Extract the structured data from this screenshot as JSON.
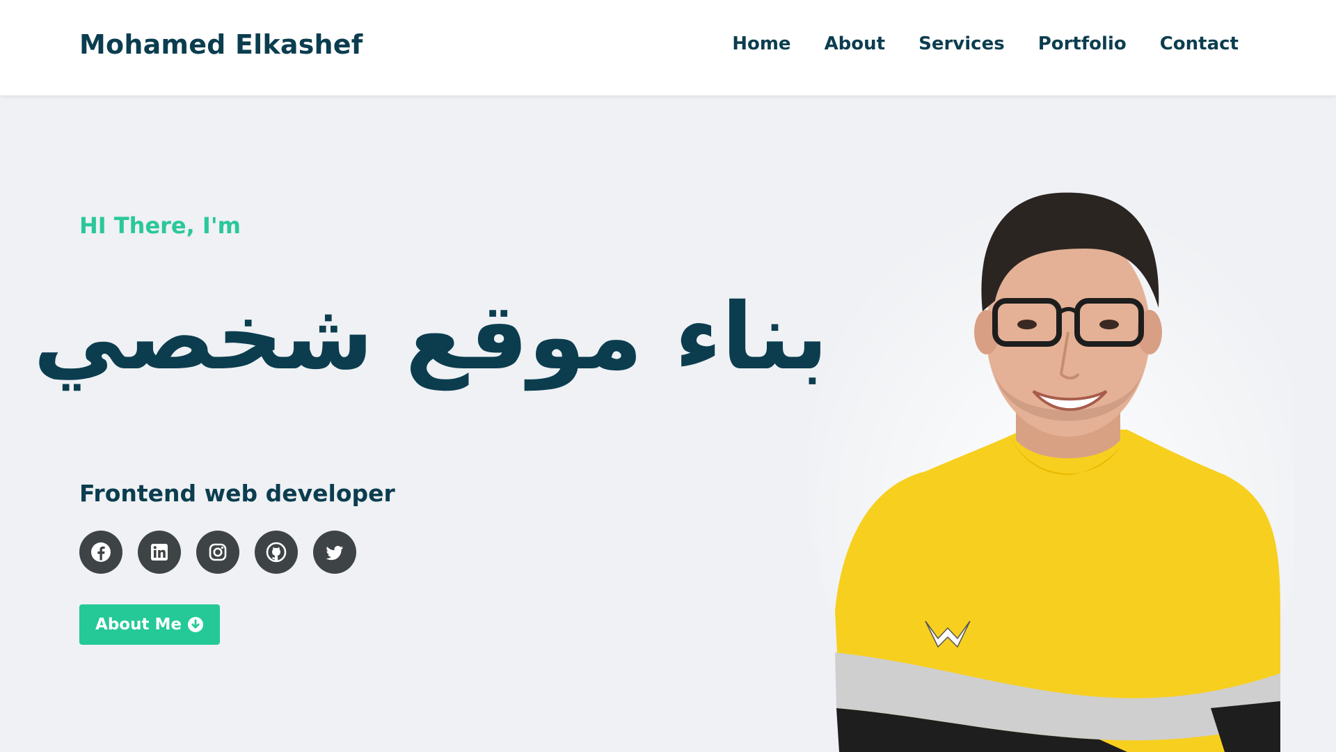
{
  "header": {
    "brand": "Mohamed Elkashef",
    "nav": [
      "Home",
      "About",
      "Services",
      "Portfolio",
      "Contact"
    ]
  },
  "hero": {
    "greeting": "HI There, I'm",
    "headline": "بناء موقع شخصي",
    "role": "Frontend web developer",
    "cta_label": "About Me",
    "cta_icon": "arrow-circle-down-icon",
    "socials": [
      "facebook-icon",
      "linkedin-icon",
      "instagram-icon",
      "github-icon",
      "twitter-icon"
    ]
  },
  "colors": {
    "primary": "#0b3d4f",
    "accent": "#24c997",
    "background": "#eff1f4",
    "icon_bg": "#3e4346",
    "shirt": "#f7cf1f"
  }
}
